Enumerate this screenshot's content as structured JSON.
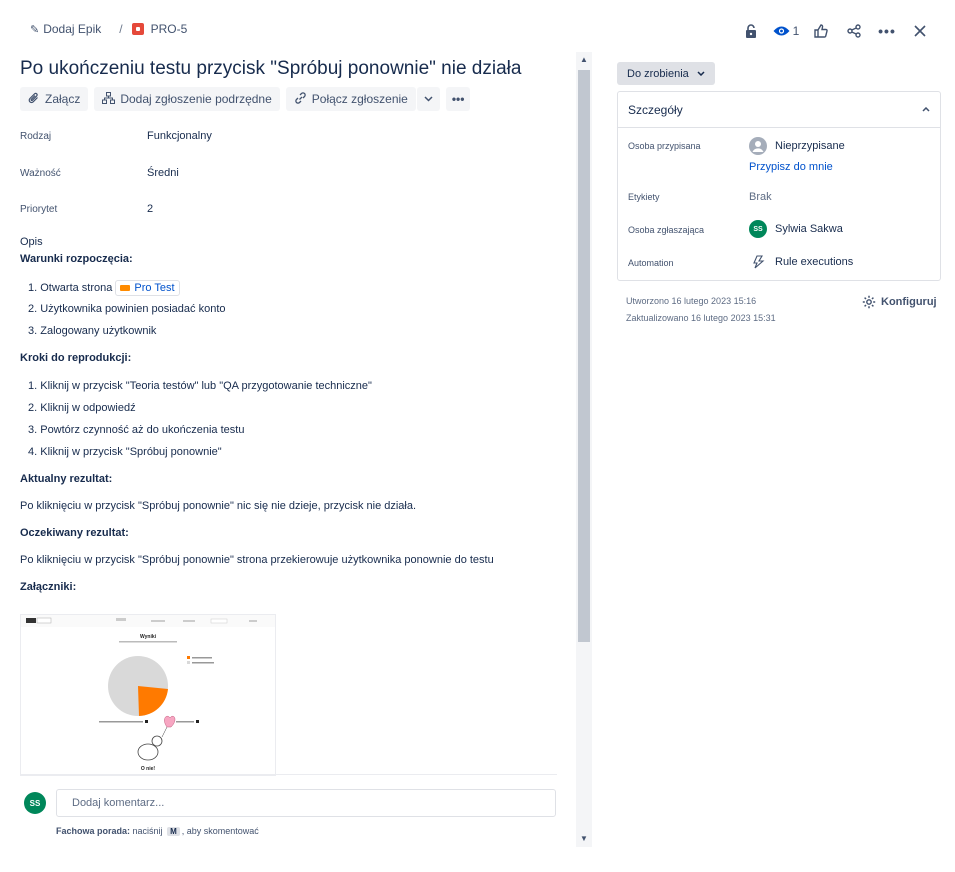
{
  "breadcrumb": {
    "epic": "Dodaj Epik",
    "separator": "/",
    "issue_key": "PRO-5"
  },
  "toolbar": {
    "watch_count": "1"
  },
  "issue": {
    "title": "Po ukończeniu testu przycisk \"Spróbuj ponownie\" nie działa"
  },
  "actions": {
    "attach": "Załącz",
    "child": "Dodaj zgłoszenie podrzędne",
    "link": "Połącz zgłoszenie"
  },
  "fields": [
    {
      "label": "Rodzaj",
      "value": "Funkcjonalny"
    },
    {
      "label": "Ważność",
      "value": "Średni"
    },
    {
      "label": "Priorytet",
      "value": "2"
    }
  ],
  "description": {
    "label": "Opis",
    "preconditions_h": "Warunki rozpoczęcia:",
    "pre": [
      "1. Otwarta strona",
      "2. Użytkownika powinien posiadać konto",
      "3. Zalogowany użytkownik"
    ],
    "link_text": "Pro Test",
    "steps_h": "Kroki do reprodukcji:",
    "steps": [
      "1. Kliknij w przycisk \"Teoria testów\" lub \"QA przygotowanie techniczne\"",
      "2. Kliknij w odpowiedź",
      "3. Powtórz czynność aż do ukończenia testu",
      "4. Kliknij w przycisk \"Spróbuj ponownie\""
    ],
    "actual_h": "Aktualny rezultat:",
    "actual": "Po kliknięciu w przycisk \"Spróbuj ponownie\" nic się nie dzieje, przycisk nie działa.",
    "expected_h": "Oczekiwany rezultat:",
    "expected": "Po kliknięciu w przycisk \"Spróbuj ponownie\" strona przekierowuje użytkownika ponownie do testu",
    "attachments_h": "Załączniki:"
  },
  "attachment": {
    "heading": "Wyniki",
    "caption": "O nie!"
  },
  "comment": {
    "avatar": "SS",
    "placeholder": "Dodaj komentarz...",
    "tip_bold": "Fachowa porada:",
    "tip_pre": "naciśnij",
    "tip_key": "M",
    "tip_post": ", aby skomentować"
  },
  "status": {
    "label": "Do zrobienia"
  },
  "details": {
    "title": "Szczegóły",
    "assignee_label": "Osoba przypisana",
    "assignee": "Nieprzypisane",
    "assign_me": "Przypisz do mnie",
    "labels_label": "Etykiety",
    "labels": "Brak",
    "reporter_label": "Osoba zgłaszająca",
    "reporter_avatar": "SS",
    "reporter": "Sylwia Sakwa",
    "automation_label": "Automation",
    "automation": "Rule executions"
  },
  "meta": {
    "created": "Utworzono 16 lutego 2023 15:16",
    "updated": "Zaktualizowano 16 lutego 2023 15:31",
    "configure": "Konfiguruj"
  },
  "colors": {
    "link": "#0052cc",
    "status_bg": "#dfe1e6",
    "avatar": "#00875a",
    "issue_type": "#e5493a",
    "pie_orange": "#ff7a00"
  }
}
